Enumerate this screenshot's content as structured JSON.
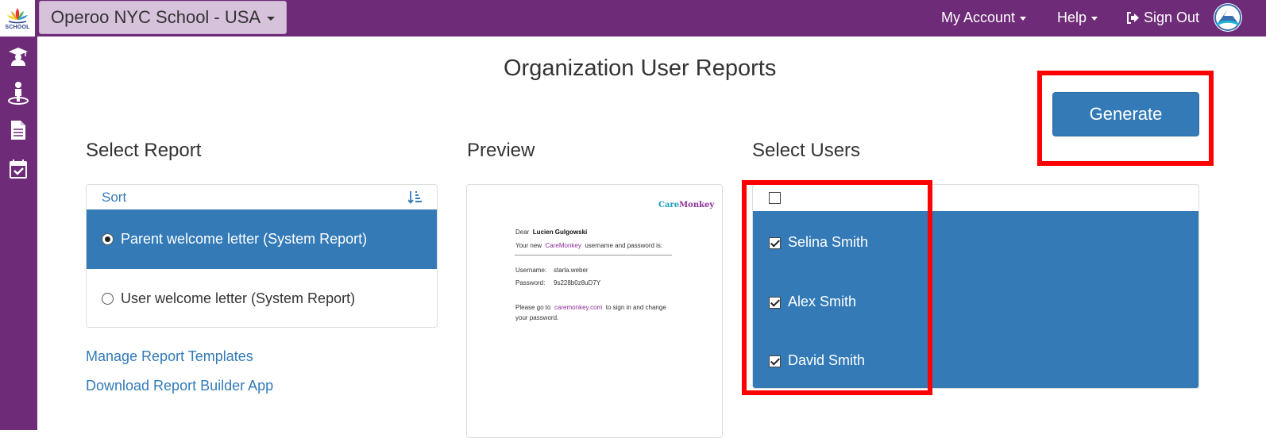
{
  "app": {
    "logo_text": "SCHOOL",
    "org_selector": "Operoo NYC School - USA"
  },
  "nav": {
    "account": "My Account",
    "help": "Help",
    "signout": "Sign Out"
  },
  "sidebar": {
    "icons": [
      "graduate-icon",
      "person-icon",
      "document-icon",
      "calendar-check-icon"
    ]
  },
  "page": {
    "title": "Organization User Reports",
    "generate": "Generate"
  },
  "select_report": {
    "heading": "Select Report",
    "sort_label": "Sort",
    "items": [
      {
        "label": "Parent welcome letter (System Report)",
        "selected": true
      },
      {
        "label": "User welcome letter (System Report)",
        "selected": false
      }
    ],
    "links": {
      "manage": "Manage Report Templates",
      "download": "Download Report Builder App"
    }
  },
  "preview": {
    "heading": "Preview",
    "brand_prefix": "Care",
    "brand_suffix": "Monkey",
    "dear": "Dear",
    "recipient": "Lucien Gulgowski",
    "line1_pre": "Your new",
    "line1_brand": "CareMonkey",
    "line1_post": "username and password is:",
    "username_label": "Username:",
    "username_value": "starla.weber",
    "password_label": "Password:",
    "password_value": "9s228b0z8uD7Y",
    "line2_pre": "Please go to",
    "line2_link": "caremonkey.com",
    "line2_post": "to sign in and change",
    "line3": "your password."
  },
  "select_users": {
    "heading": "Select Users",
    "users": [
      {
        "name": "Selina Smith",
        "checked": true
      },
      {
        "name": "Alex Smith",
        "checked": true
      },
      {
        "name": "David Smith",
        "checked": true
      }
    ]
  },
  "colors": {
    "brand_purple": "#6e2b77",
    "primary_blue": "#337ab7",
    "highlight_red": "#ff0000"
  }
}
